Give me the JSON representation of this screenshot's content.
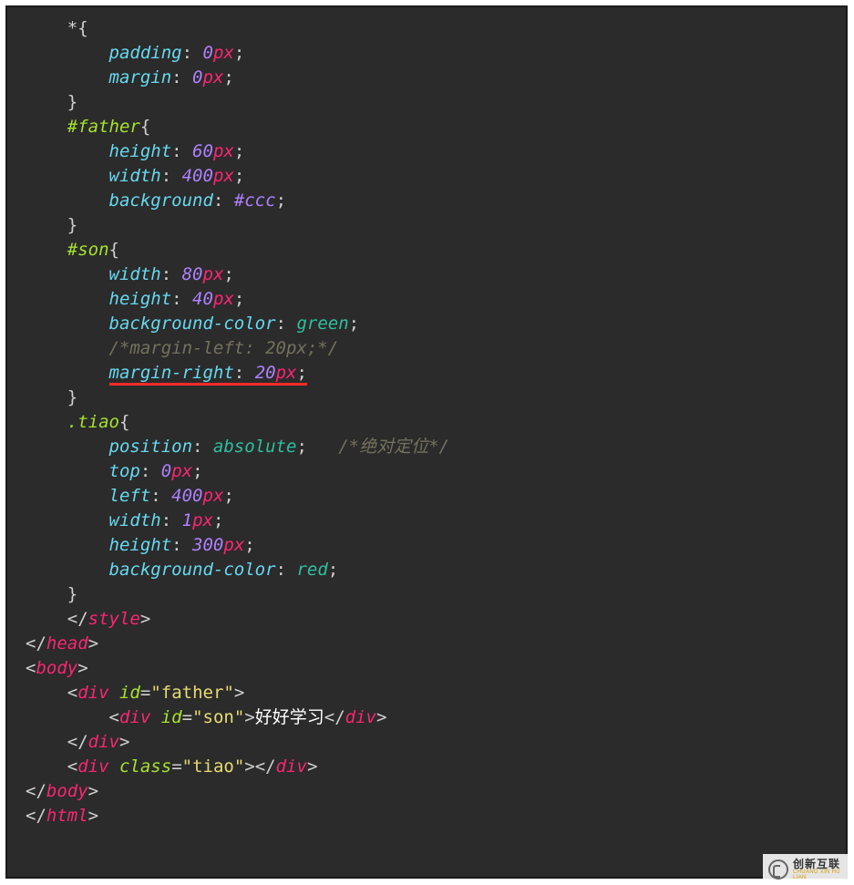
{
  "code": {
    "lines": [
      [
        {
          "cls": "t-punct",
          "indent": 4,
          "text": "*{"
        }
      ],
      [
        {
          "cls": "t-prop",
          "indent": 8,
          "text": "padding"
        },
        {
          "cls": "t-punct",
          "text": ": "
        },
        {
          "cls": "t-num",
          "text": "0"
        },
        {
          "cls": "t-unit",
          "text": "px"
        },
        {
          "cls": "t-punct",
          "text": ";"
        }
      ],
      [
        {
          "cls": "t-prop",
          "indent": 8,
          "text": "margin"
        },
        {
          "cls": "t-punct",
          "text": ": "
        },
        {
          "cls": "t-num",
          "text": "0"
        },
        {
          "cls": "t-unit",
          "text": "px"
        },
        {
          "cls": "t-punct",
          "text": ";"
        }
      ],
      [
        {
          "cls": "t-punct",
          "indent": 4,
          "text": "}"
        }
      ],
      [
        {
          "cls": "t-sel",
          "indent": 4,
          "text": "#father"
        },
        {
          "cls": "t-punct",
          "text": "{"
        }
      ],
      [
        {
          "cls": "t-prop",
          "indent": 8,
          "text": "height"
        },
        {
          "cls": "t-punct",
          "text": ": "
        },
        {
          "cls": "t-num",
          "text": "60"
        },
        {
          "cls": "t-unit",
          "text": "px"
        },
        {
          "cls": "t-punct",
          "text": ";"
        }
      ],
      [
        {
          "cls": "t-prop",
          "indent": 8,
          "text": "width"
        },
        {
          "cls": "t-punct",
          "text": ": "
        },
        {
          "cls": "t-num",
          "text": "400"
        },
        {
          "cls": "t-unit",
          "text": "px"
        },
        {
          "cls": "t-punct",
          "text": ";"
        }
      ],
      [
        {
          "cls": "t-prop",
          "indent": 8,
          "text": "background"
        },
        {
          "cls": "t-punct",
          "text": ": "
        },
        {
          "cls": "t-num",
          "text": "#ccc"
        },
        {
          "cls": "t-punct",
          "text": ";"
        }
      ],
      [
        {
          "cls": "t-punct",
          "indent": 4,
          "text": "}"
        }
      ],
      [
        {
          "cls": "t-sel",
          "indent": 4,
          "text": "#son"
        },
        {
          "cls": "t-punct",
          "text": "{"
        }
      ],
      [
        {
          "cls": "t-prop",
          "indent": 8,
          "text": "width"
        },
        {
          "cls": "t-punct",
          "text": ": "
        },
        {
          "cls": "t-num",
          "text": "80"
        },
        {
          "cls": "t-unit",
          "text": "px"
        },
        {
          "cls": "t-punct",
          "text": ";"
        }
      ],
      [
        {
          "cls": "t-prop",
          "indent": 8,
          "text": "height"
        },
        {
          "cls": "t-punct",
          "text": ": "
        },
        {
          "cls": "t-num",
          "text": "40"
        },
        {
          "cls": "t-unit",
          "text": "px"
        },
        {
          "cls": "t-punct",
          "text": ";"
        }
      ],
      [
        {
          "cls": "t-prop",
          "indent": 8,
          "text": "background-color"
        },
        {
          "cls": "t-punct",
          "text": ": "
        },
        {
          "cls": "t-val",
          "text": "green"
        },
        {
          "cls": "t-punct",
          "text": ";"
        }
      ],
      [
        {
          "cls": "t-comment",
          "indent": 8,
          "text": "/*margin-left: 20px;*/"
        }
      ],
      [
        {
          "cls": "t-prop underline-red",
          "indent": 8,
          "text": "margin-right"
        },
        {
          "cls": "t-punct underline-red",
          "text": ": "
        },
        {
          "cls": "t-num underline-red",
          "text": "20"
        },
        {
          "cls": "t-unit underline-red",
          "text": "px"
        },
        {
          "cls": "t-punct underline-red",
          "text": ";"
        }
      ],
      [
        {
          "cls": "t-punct",
          "indent": 4,
          "text": "}"
        }
      ],
      [
        {
          "cls": "t-sel",
          "indent": 4,
          "text": ".tiao"
        },
        {
          "cls": "t-punct",
          "text": "{"
        }
      ],
      [
        {
          "cls": "t-prop",
          "indent": 8,
          "text": "position"
        },
        {
          "cls": "t-punct",
          "text": ": "
        },
        {
          "cls": "t-val",
          "text": "absolute"
        },
        {
          "cls": "t-punct",
          "text": ";   "
        },
        {
          "cls": "t-comment",
          "text": "/*绝对定位*/"
        }
      ],
      [
        {
          "cls": "t-prop",
          "indent": 8,
          "text": "top"
        },
        {
          "cls": "t-punct",
          "text": ": "
        },
        {
          "cls": "t-num",
          "text": "0"
        },
        {
          "cls": "t-unit",
          "text": "px"
        },
        {
          "cls": "t-punct",
          "text": ";"
        }
      ],
      [
        {
          "cls": "t-prop",
          "indent": 8,
          "text": "left"
        },
        {
          "cls": "t-punct",
          "text": ": "
        },
        {
          "cls": "t-num",
          "text": "400"
        },
        {
          "cls": "t-unit",
          "text": "px"
        },
        {
          "cls": "t-punct",
          "text": ";"
        }
      ],
      [
        {
          "cls": "t-prop",
          "indent": 8,
          "text": "width"
        },
        {
          "cls": "t-punct",
          "text": ": "
        },
        {
          "cls": "t-num",
          "text": "1"
        },
        {
          "cls": "t-unit",
          "text": "px"
        },
        {
          "cls": "t-punct",
          "text": ";"
        }
      ],
      [
        {
          "cls": "t-prop",
          "indent": 8,
          "text": "height"
        },
        {
          "cls": "t-punct",
          "text": ": "
        },
        {
          "cls": "t-num",
          "text": "300"
        },
        {
          "cls": "t-unit",
          "text": "px"
        },
        {
          "cls": "t-punct",
          "text": ";"
        }
      ],
      [
        {
          "cls": "t-prop",
          "indent": 8,
          "text": "background-color"
        },
        {
          "cls": "t-punct",
          "text": ": "
        },
        {
          "cls": "t-val",
          "text": "red"
        },
        {
          "cls": "t-punct",
          "text": ";"
        }
      ],
      [
        {
          "cls": "t-punct",
          "indent": 4,
          "text": "}"
        }
      ],
      [
        {
          "cls": "t-punct",
          "indent": 4,
          "text": "</"
        },
        {
          "cls": "t-tag",
          "text": "style"
        },
        {
          "cls": "t-punct",
          "text": ">"
        }
      ],
      [
        {
          "cls": "t-punct",
          "indent": 0,
          "text": "</"
        },
        {
          "cls": "t-tag",
          "text": "head"
        },
        {
          "cls": "t-punct",
          "text": ">"
        }
      ],
      [
        {
          "cls": "t-punct",
          "indent": 0,
          "text": "<"
        },
        {
          "cls": "t-tag",
          "text": "body"
        },
        {
          "cls": "t-punct",
          "text": ">"
        }
      ],
      [
        {
          "cls": "t-punct",
          "indent": 4,
          "text": "<"
        },
        {
          "cls": "t-tag",
          "text": "div"
        },
        {
          "cls": "t-attr",
          "text": " id"
        },
        {
          "cls": "t-punct",
          "text": "="
        },
        {
          "cls": "t-str",
          "text": "\"father\""
        },
        {
          "cls": "t-punct",
          "text": ">"
        }
      ],
      [
        {
          "cls": "t-punct",
          "indent": 8,
          "text": "<"
        },
        {
          "cls": "t-tag",
          "text": "div"
        },
        {
          "cls": "t-attr",
          "text": " id"
        },
        {
          "cls": "t-punct",
          "text": "="
        },
        {
          "cls": "t-str",
          "text": "\"son\""
        },
        {
          "cls": "t-punct",
          "text": ">"
        },
        {
          "cls": "t-text",
          "text": "好好学习"
        },
        {
          "cls": "t-punct",
          "text": "</"
        },
        {
          "cls": "t-tag",
          "text": "div"
        },
        {
          "cls": "t-punct",
          "text": ">"
        }
      ],
      [
        {
          "cls": "t-punct",
          "indent": 4,
          "text": "</"
        },
        {
          "cls": "t-tag",
          "text": "div"
        },
        {
          "cls": "t-punct",
          "text": ">"
        }
      ],
      [
        {
          "cls": "t-punct",
          "indent": 4,
          "text": "<"
        },
        {
          "cls": "t-tag",
          "text": "div"
        },
        {
          "cls": "t-attr",
          "text": " class"
        },
        {
          "cls": "t-punct",
          "text": "="
        },
        {
          "cls": "t-str",
          "text": "\"tiao\""
        },
        {
          "cls": "t-punct",
          "text": "></"
        },
        {
          "cls": "t-tag",
          "text": "div"
        },
        {
          "cls": "t-punct",
          "text": ">"
        }
      ],
      [
        {
          "cls": "t-punct",
          "indent": 0,
          "text": "</"
        },
        {
          "cls": "t-tag",
          "text": "body"
        },
        {
          "cls": "t-punct",
          "text": ">"
        }
      ],
      [
        {
          "cls": "t-punct",
          "indent": 0,
          "text": "</"
        },
        {
          "cls": "t-tag",
          "text": "html"
        },
        {
          "cls": "t-punct",
          "text": ">"
        }
      ]
    ]
  },
  "watermark": {
    "cn": "创新互联",
    "en": "CHUANG XIN HU LIAN"
  }
}
